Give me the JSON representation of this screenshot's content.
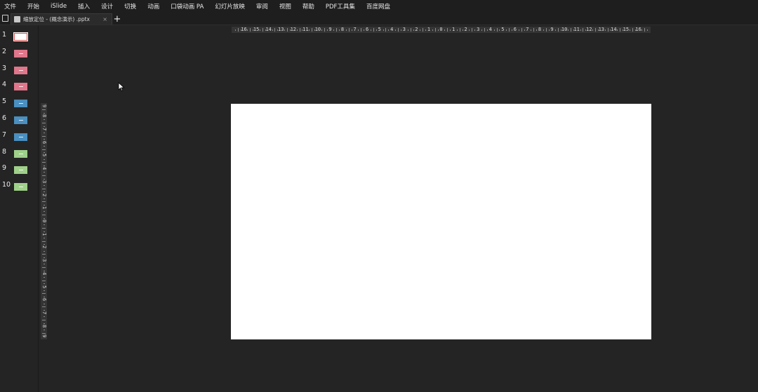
{
  "menubar": {
    "items": [
      "文件",
      "开始",
      "iSlide",
      "插入",
      "设计",
      "切换",
      "动画",
      "口袋动画 PA",
      "幻灯片放映",
      "审阅",
      "视图",
      "帮助",
      "PDF工具集",
      "百度网盘"
    ]
  },
  "tabs": {
    "active_title": "缩放定位 - (概念演示) .pptx",
    "close_symbol": "×",
    "new_tab_symbol": "+"
  },
  "slides": {
    "numbers": [
      "1",
      "2",
      "3",
      "4",
      "5",
      "6",
      "7",
      "8",
      "9",
      "10"
    ],
    "thumb_colors": [
      "#ffffff",
      "#e0768b",
      "#e0768b",
      "#e0768b",
      "#4a8fc0",
      "#4a8fc0",
      "#4a8fc0",
      "#9fd08a",
      "#9fd08a",
      "#9fd08a"
    ],
    "selected_index": 0
  },
  "rulers": {
    "horizontal_labels": [
      "16",
      "15",
      "14",
      "13",
      "12",
      "11",
      "10",
      "9",
      "8",
      "7",
      "6",
      "5",
      "4",
      "3",
      "2",
      "1",
      "0",
      "1",
      "2",
      "3",
      "4",
      "5",
      "6",
      "7",
      "8",
      "9",
      "10",
      "11",
      "12",
      "13",
      "14",
      "15",
      "16"
    ],
    "vertical_labels": [
      "9",
      "8",
      "7",
      "6",
      "5",
      "4",
      "3",
      "2",
      "1",
      "0",
      "1",
      "2",
      "3",
      "4",
      "5",
      "6",
      "7",
      "8",
      "9"
    ]
  },
  "colors": {
    "background": "#242424",
    "slide": "#ffffff",
    "ruler": "#343434"
  }
}
